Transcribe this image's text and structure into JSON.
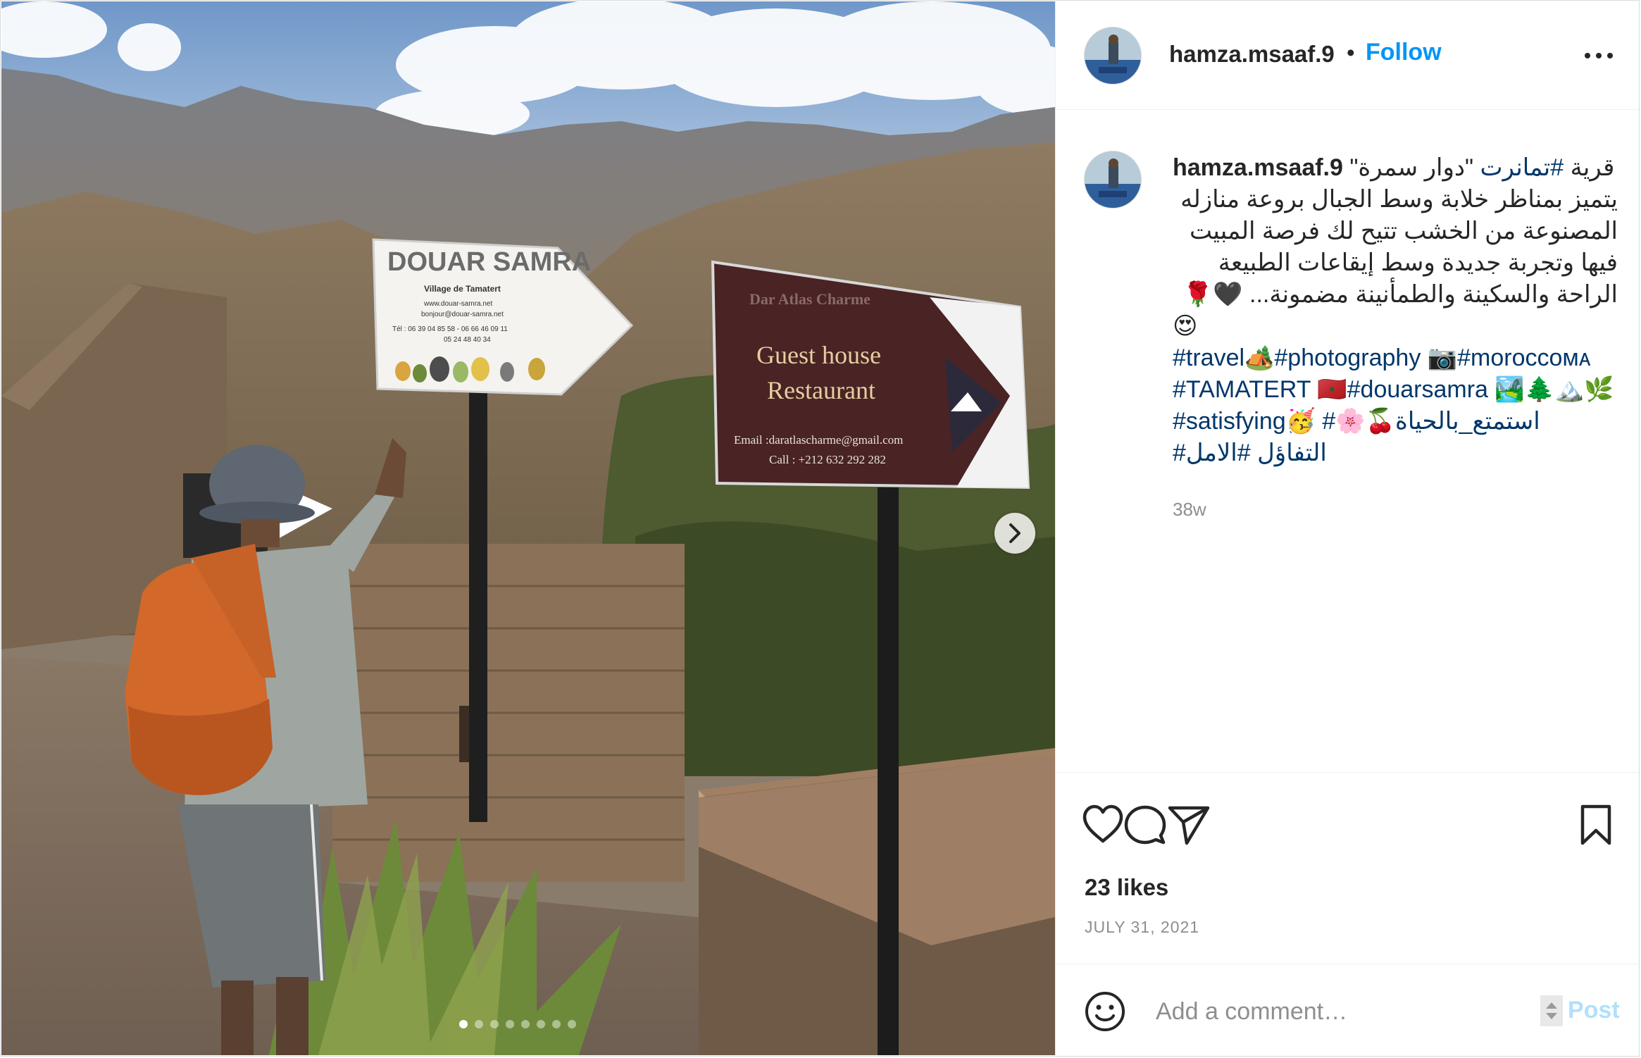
{
  "post": {
    "username": "hamza.msaaf.9",
    "separator": "•",
    "follow_label": "Follow",
    "more_label": "More options"
  },
  "photo": {
    "sign_left_title": "DOUAR SAMRA",
    "sign_left_sub": "Village de Tamatert",
    "sign_left_web": "www.douar-samra.net",
    "sign_left_mail": "bonjour@douar-samra.net",
    "sign_left_tel": "Tél : 06 39 04 85 58 - 06 66 46 09 11",
    "sign_left_tel2": "05 24 48 40 34",
    "sign_right_title": "Dar Atlas Charme",
    "sign_right_line1": "Guest house",
    "sign_right_line2": "Restaurant",
    "sign_right_email": "Email :daratlascharme@gmail.com",
    "sign_right_call": "Call : +212 632 292 282",
    "carousel_count": 8,
    "carousel_active": 1
  },
  "caption": {
    "username": "hamza.msaaf.9",
    "line1_pre": "قرية ",
    "line1_tag": "#تمانرت",
    "line1_post": " \"دوار سمرة\"",
    "line2": "يتميز بمناظر خلابة وسط الجبال بروعة منازله",
    "line3": "المصنوعة من الخشب تتيح لك فرصة المبيت",
    "line4": "فيها وتجربة جديدة وسط إيقاعات الطبيعة",
    "line5": "الراحة والسكينة والطمأنينة مضمونة... 🖤🌹",
    "line6": "😍",
    "line7": "#travel🏕️#photography 📷#moroccoᴍᴀ",
    "line8": "#TAMATERT 🇲🇦#douarsamra 🏞️🌲🏔️🌿",
    "line9": "#satisfying🥳 #🌸🍒استمتع_بالحياة",
    "line10": "#التفاؤل #الامل",
    "time_ago": "38w"
  },
  "actions": {
    "likes": "23 likes",
    "date": "JULY 31, 2021"
  },
  "comment": {
    "placeholder": "Add a comment…",
    "post_label": "Post"
  },
  "colors": {
    "link_blue": "#0095f6",
    "hashtag": "#00376b",
    "muted": "#8e8e8e",
    "post_disabled": "#b2dffc"
  }
}
